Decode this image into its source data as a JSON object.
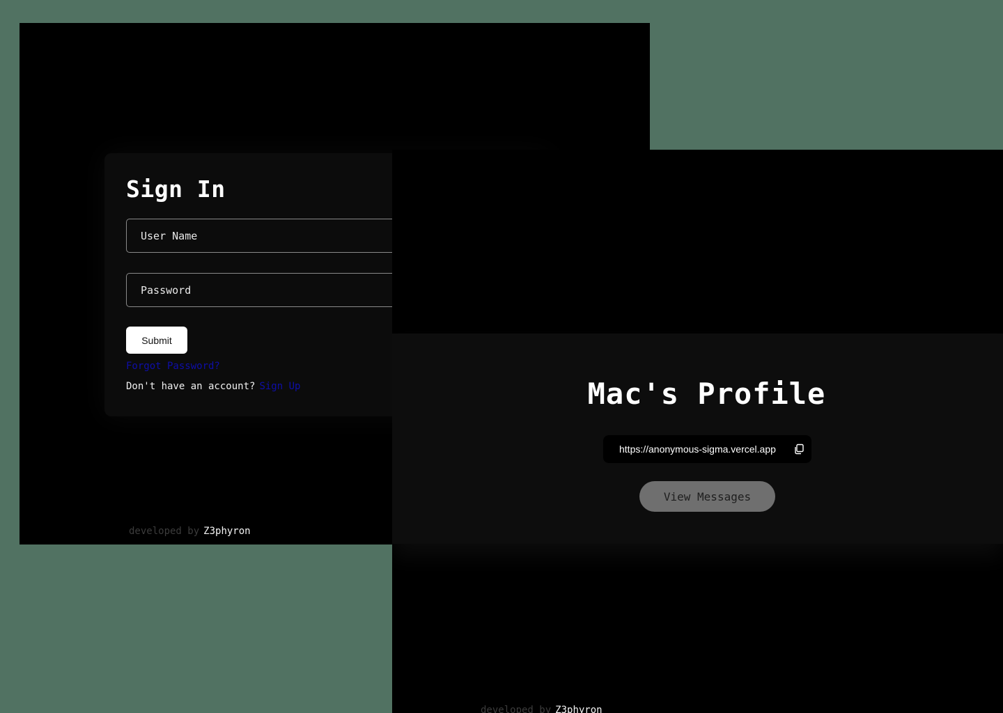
{
  "signin": {
    "title": "Sign In",
    "username_placeholder": "User Name",
    "password_placeholder": "Password",
    "submit_label": "Submit",
    "forgot_label": "Forgot Password?",
    "no_account_text": "Don't have an account?",
    "signup_label": "Sign Up",
    "footer_prefix": "developed by",
    "footer_author": "Z3phyron"
  },
  "profile": {
    "title": "Mac's Profile",
    "profile_link": "https://anonymous-sigma.vercel.app",
    "view_messages_label": "View Messages",
    "footer_prefix": "developed by",
    "footer_author": "Z3phyron"
  },
  "icons": {
    "copy": "copy-icon"
  },
  "colors": {
    "background": "#517262",
    "window": "#000000",
    "card": "#0c0c0c",
    "link": "#0e0ea8",
    "button_white": "#ffffff",
    "button_grey": "#6f6f6f"
  }
}
